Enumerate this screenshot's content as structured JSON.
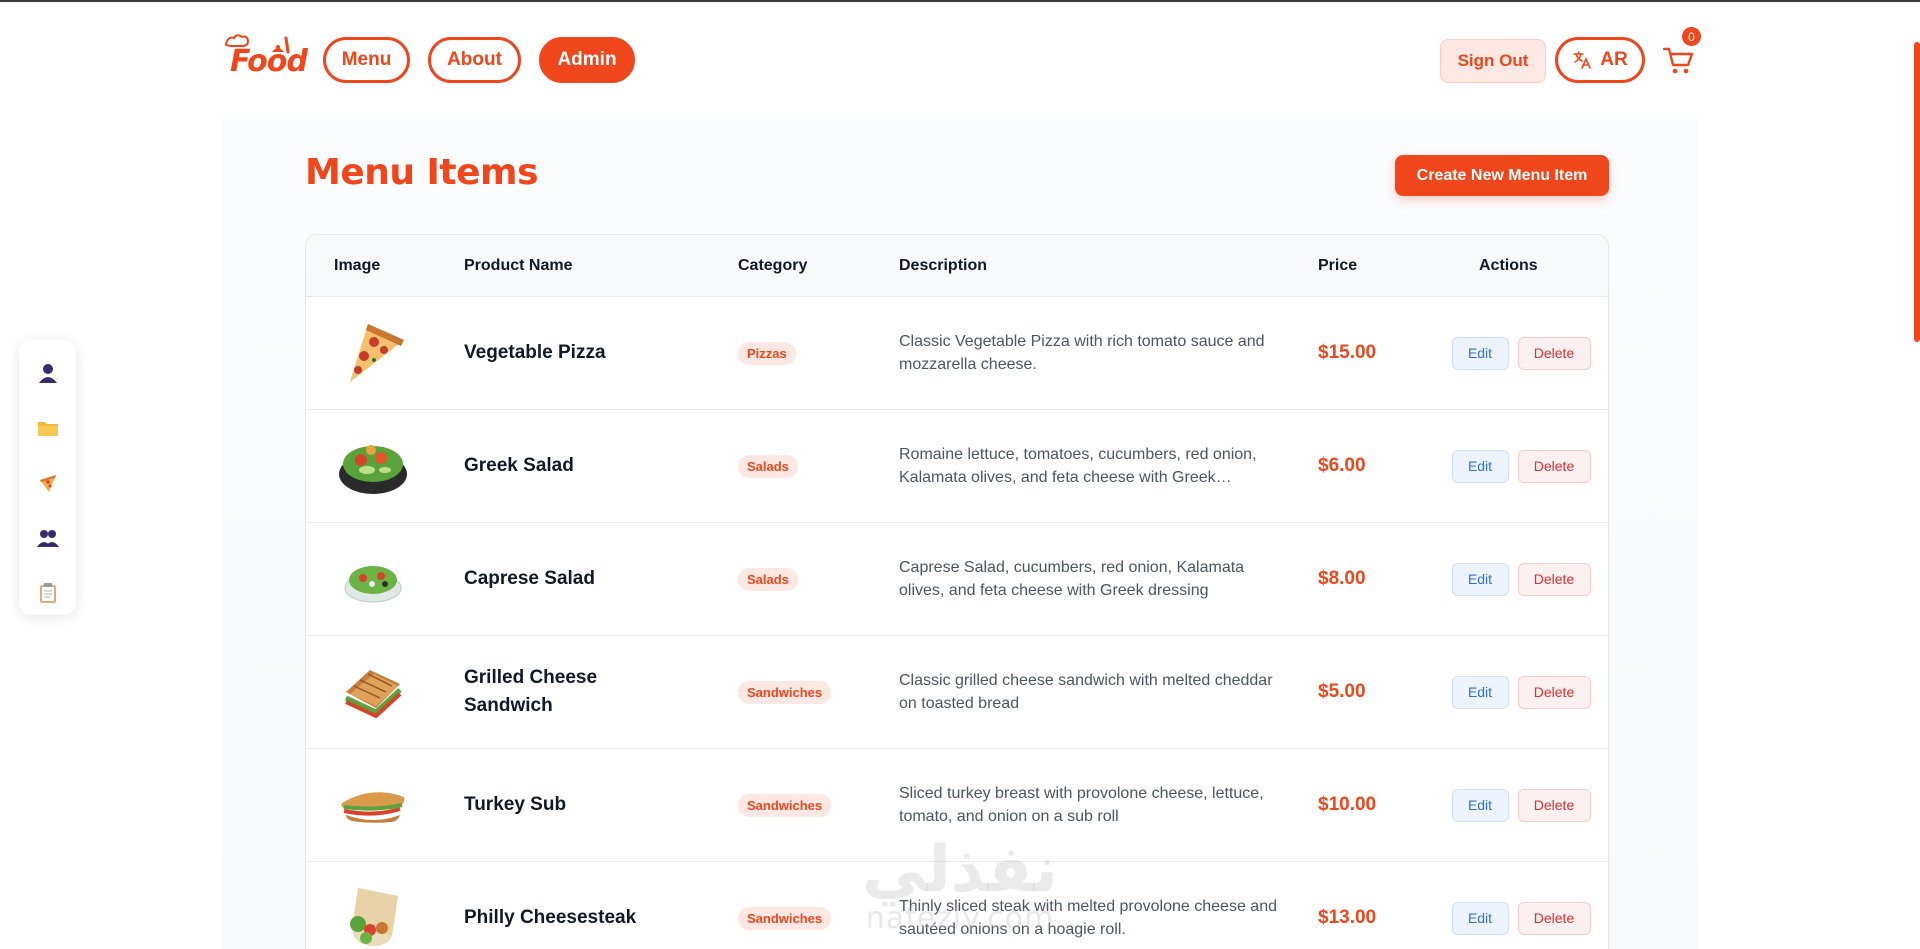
{
  "header": {
    "logo_text": "Food",
    "nav": [
      {
        "label": "Menu",
        "active": false
      },
      {
        "label": "About",
        "active": false
      },
      {
        "label": "Admin",
        "active": true
      }
    ],
    "sign_out_label": "Sign Out",
    "language_label": "AR",
    "cart_count": "0"
  },
  "sidebar": {
    "items": [
      {
        "icon": "user-icon"
      },
      {
        "icon": "folder-icon"
      },
      {
        "icon": "pizza-icon"
      },
      {
        "icon": "users-icon"
      },
      {
        "icon": "clipboard-icon"
      }
    ]
  },
  "main": {
    "title": "Menu Items",
    "create_button_label": "Create New Menu Item",
    "table": {
      "headers": {
        "image": "Image",
        "name": "Product Name",
        "category": "Category",
        "description": "Description",
        "price": "Price",
        "actions": "Actions"
      },
      "rows": [
        {
          "image_icon": "pizza-slice-image",
          "name": "Vegetable Pizza",
          "category": "Pizzas",
          "description": "Classic Vegetable Pizza with rich tomato sauce and mozzarella cheese.",
          "price": "$15.00"
        },
        {
          "image_icon": "greek-salad-image",
          "name": "Greek Salad",
          "category": "Salads",
          "description": "Romaine lettuce, tomatoes, cucumbers, red onion, Kalamata olives, and feta cheese with Greek dressing",
          "price": "$6.00"
        },
        {
          "image_icon": "caprese-salad-image",
          "name": "Caprese Salad",
          "category": "Salads",
          "description": "Caprese Salad, cucumbers, red onion, Kalamata olives, and feta cheese with Greek dressing",
          "price": "$8.00"
        },
        {
          "image_icon": "sandwich-image",
          "name": "Grilled Cheese Sandwich",
          "category": "Sandwiches",
          "description": "Classic grilled cheese sandwich with melted cheddar on toasted bread",
          "price": "$5.00"
        },
        {
          "image_icon": "sub-image",
          "name": "Turkey Sub",
          "category": "Sandwiches",
          "description": "Sliced turkey breast with provolone cheese, lettuce, tomato, and onion on a sub roll",
          "price": "$10.00"
        },
        {
          "image_icon": "wrap-image",
          "name": "Philly Cheesesteak",
          "category": "Sandwiches",
          "description": "Thinly sliced steak with melted provolone cheese and sautéed onions on a hoagie roll.",
          "price": "$13.00"
        }
      ],
      "edit_label": "Edit",
      "delete_label": "Delete"
    }
  },
  "watermark": {
    "arabic": "نفذلي",
    "latin": "nafezly.com"
  },
  "colors": {
    "accent": "#f0461c",
    "edit_blue": "#2f6fd6",
    "delete_red": "#d93030"
  }
}
